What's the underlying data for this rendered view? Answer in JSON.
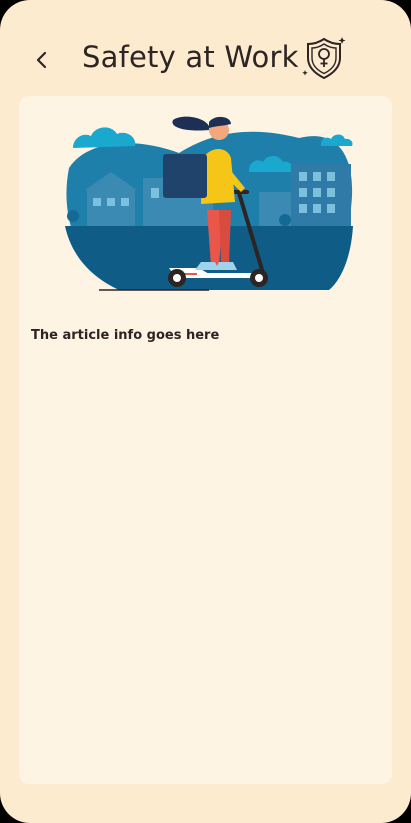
{
  "header": {
    "title": "Safety at Work",
    "back_icon": "chevron-left-icon",
    "badge_icon": "shield-female-icon"
  },
  "article": {
    "info": "The article info goes here"
  },
  "colors": {
    "background": "#fdebd0",
    "card": "#fef4e4",
    "text": "#2d2424",
    "illustration_blue": "#1f6f9a",
    "illustration_dark": "#0f5d86",
    "rider_jacket": "#f5c518",
    "rider_pants": "#e8574a"
  }
}
